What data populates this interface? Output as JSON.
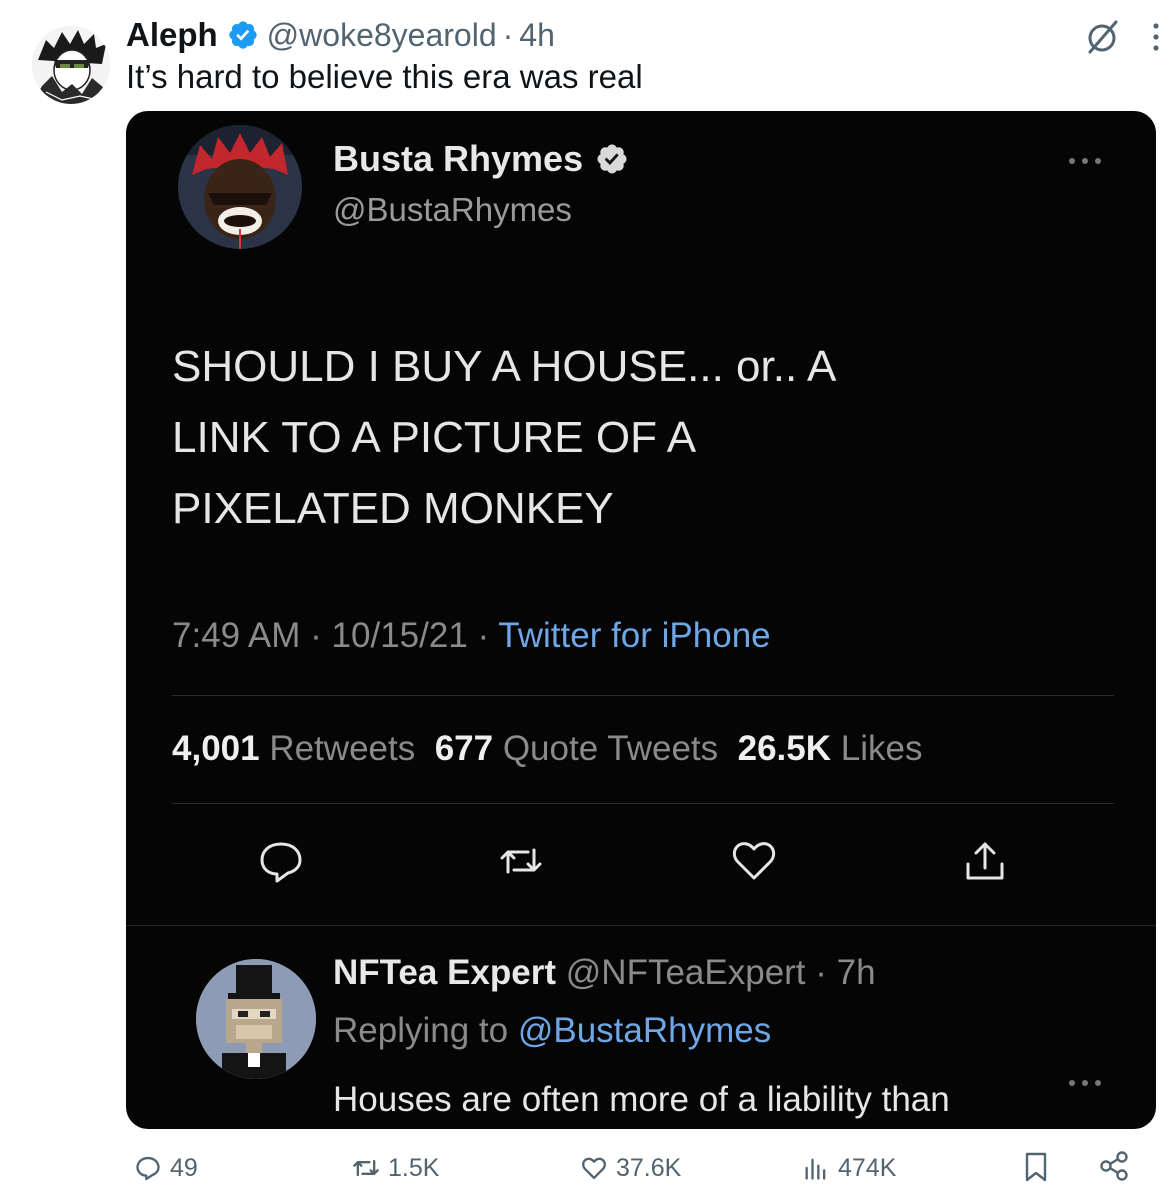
{
  "post": {
    "author_name": "Aleph",
    "author_handle": "@woke8yearold",
    "separator": "·",
    "time": "4h",
    "text": "It’s hard to believe this era was real",
    "icons": {
      "avatar": "anime-sketch-avatar",
      "verified": "verified-badge-icon",
      "grok": "grok-icon",
      "more": "more-vertical-icon"
    },
    "colors": {
      "verified": "#1d9bf0",
      "text": "#0f1419",
      "muted": "#536471"
    }
  },
  "embedded": {
    "name": "Busta Rhymes",
    "handle": "@BustaRhymes",
    "text_lines": [
      "SHOULD I BUY A HOUSE... or.. A",
      "LINK TO A PICTURE OF A",
      "PIXELATED MONKEY"
    ],
    "time": "7:49 AM",
    "separator": "·",
    "date": "10/15/21",
    "source": "Twitter for iPhone",
    "retweets_count": "4,001",
    "retweets_label": "Retweets",
    "quotes_count": "677",
    "quotes_label": "Quote Tweets",
    "likes_count": "26.5K",
    "likes_label": "Likes",
    "reply": {
      "name": "NFTea Expert",
      "handle": "@NFTeaExpert",
      "separator": "·",
      "time": "7h",
      "replying_prefix": "Replying to",
      "replying_to": "@BustaRhymes",
      "text": "Houses are often more of a liability than"
    },
    "colors": {
      "background": "#050506",
      "link": "#6ea6e6",
      "text": "#e6e6e6",
      "muted": "#8a8a8a"
    }
  },
  "actions": {
    "replies": "49",
    "reposts": "1.5K",
    "likes": "37.6K",
    "views": "474K",
    "icons": [
      "reply-icon",
      "repost-icon",
      "like-icon",
      "views-icon",
      "bookmark-icon",
      "share-icon"
    ]
  }
}
